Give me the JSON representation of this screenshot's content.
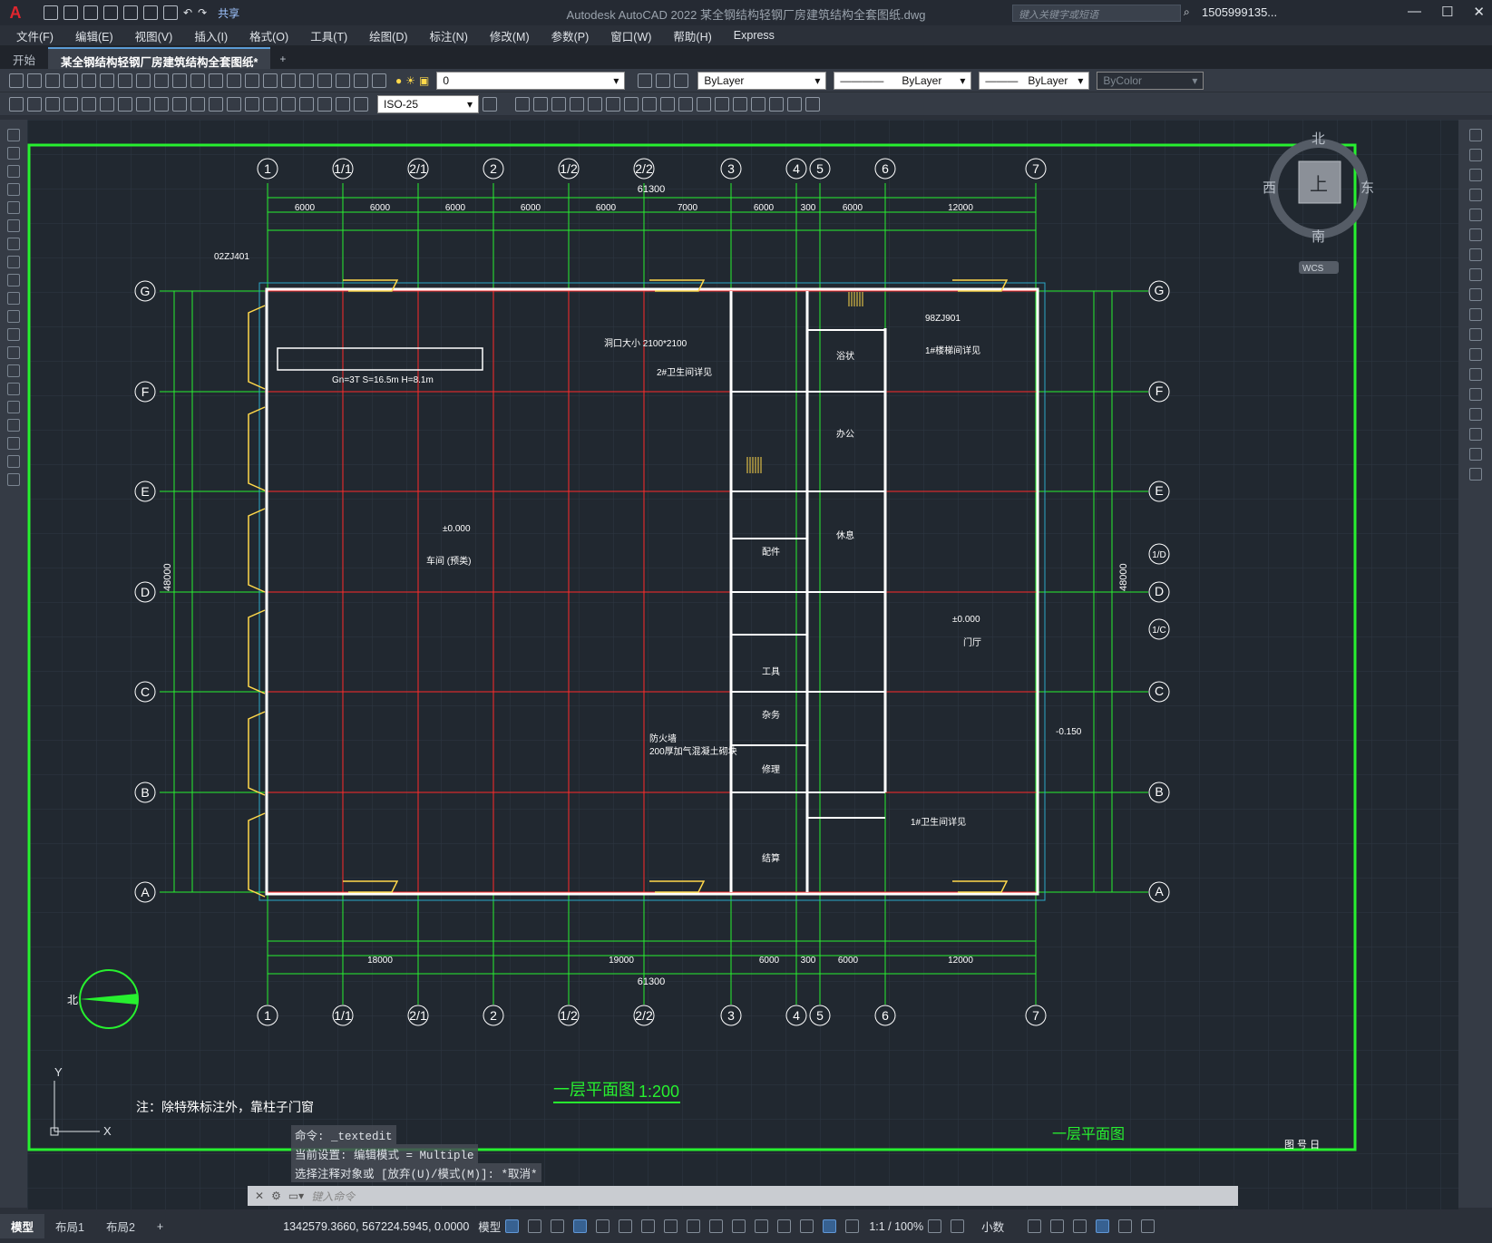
{
  "app": {
    "title": "Autodesk AutoCAD 2022    某全钢结构轻钢厂房建筑结构全套图纸.dwg",
    "share": "共享",
    "search_placeholder": "键入关键字或短语",
    "user": "1505999135...",
    "logo": "A"
  },
  "menu": [
    "文件(F)",
    "编辑(E)",
    "视图(V)",
    "插入(I)",
    "格式(O)",
    "工具(T)",
    "绘图(D)",
    "标注(N)",
    "修改(M)",
    "参数(P)",
    "窗口(W)",
    "帮助(H)",
    "Express"
  ],
  "tabs": [
    "开始",
    "某全钢结构轻钢厂房建筑结构全套图纸*"
  ],
  "toolbar": {
    "layer": "0",
    "color": "ByLayer",
    "linetype": "ByLayer",
    "lineweight": "ByLayer",
    "plotstyle": "ByColor",
    "dimstyle": "ISO-25"
  },
  "viewcube": {
    "north": "北",
    "south": "南",
    "east": "东",
    "west": "西",
    "top": "上",
    "wcs": "WCS"
  },
  "drawing": {
    "axes_top": [
      "1",
      "1/1",
      "2/1",
      "2",
      "1/2",
      "2/2",
      "3",
      "4",
      "5",
      "6",
      "7"
    ],
    "axes_left": [
      "G",
      "F",
      "E",
      "D",
      "C",
      "B",
      "A"
    ],
    "axes_right": [
      "G",
      "F",
      "E",
      "1/D",
      "D",
      "1/C",
      "C",
      "B",
      "A"
    ],
    "dim_total": "61300",
    "dim_total_v": "48000",
    "dims_top": [
      "6000",
      "6000",
      "6000",
      "6000",
      "6000",
      "7000",
      "6000",
      "300",
      "6000",
      "12000"
    ],
    "dims_bottom": [
      "18000",
      "19000",
      "6000",
      "300",
      "6000",
      "12000"
    ],
    "labels": [
      "Gn=3T  S=16.5m  H=8.1m",
      "洞口大小  2100*2100",
      "±0.000",
      "车间 (预类)",
      "浴状",
      "办公",
      "休息",
      "配件",
      "工具",
      "杂务",
      "修理",
      "结算",
      "门厅",
      "±0.000",
      "-0.150",
      "02ZJ401",
      "98ZJ901",
      "1#楼梯间详见",
      "2#卫生间详见",
      "1#卫生间详见",
      "防火墙",
      "200厚加气混凝土砌块"
    ],
    "north_label": "北",
    "plan_title": "一层平面图",
    "plan_scale": "1:200",
    "plan_title2": "一层平面图",
    "table_hdr": "图 号   日"
  },
  "command": {
    "hist1": "命令: _textedit",
    "hist2": "当前设置: 编辑模式 = Multiple",
    "hist3": "选择注释对象或 [放弃(U)/模式(M)]: *取消*",
    "placeholder": "键入命令",
    "note": "注：除特殊标注外，靠柱子门窗"
  },
  "status": {
    "tabs": [
      "模型",
      "布局1",
      "布局2"
    ],
    "coords": "1342579.3660, 567224.5945, 0.0000",
    "space": "模型",
    "scale": "1:1 / 100%",
    "units": "小数"
  }
}
